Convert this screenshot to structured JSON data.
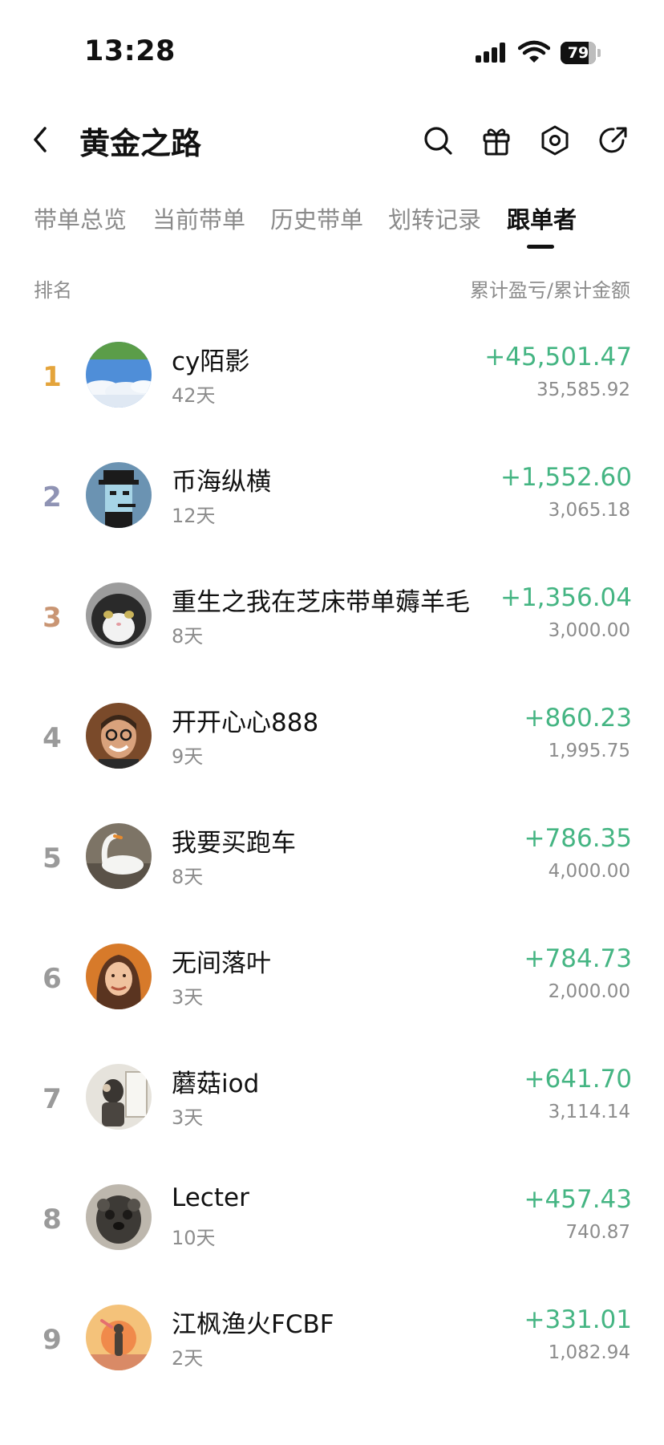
{
  "status_bar": {
    "time": "13:28",
    "battery": "79",
    "battery_level": 0.79
  },
  "header": {
    "title": "黄金之路",
    "icons": [
      "back-icon",
      "search-icon",
      "gift-icon",
      "settings-icon",
      "share-icon"
    ]
  },
  "tabs": [
    {
      "label": "带单总览",
      "active": false
    },
    {
      "label": "当前带单",
      "active": false
    },
    {
      "label": "历史带单",
      "active": false
    },
    {
      "label": "划转记录",
      "active": false
    },
    {
      "label": "跟单者",
      "active": true
    }
  ],
  "list_header": {
    "left": "排名",
    "right": "累计盈亏/累计金额"
  },
  "followers": [
    {
      "rank": "1",
      "name": "cy陌影",
      "days": "42天",
      "pnl": "+45,501.47",
      "amount": "35,585.92"
    },
    {
      "rank": "2",
      "name": "币海纵横",
      "days": "12天",
      "pnl": "+1,552.60",
      "amount": "3,065.18"
    },
    {
      "rank": "3",
      "name": "重生之我在芝床带单薅羊毛",
      "days": "8天",
      "pnl": "+1,356.04",
      "amount": "3,000.00"
    },
    {
      "rank": "4",
      "name": "开开心心888",
      "days": "9天",
      "pnl": "+860.23",
      "amount": "1,995.75"
    },
    {
      "rank": "5",
      "name": "我要买跑车",
      "days": "8天",
      "pnl": "+786.35",
      "amount": "4,000.00"
    },
    {
      "rank": "6",
      "name": "无间落叶",
      "days": "3天",
      "pnl": "+784.73",
      "amount": "2,000.00"
    },
    {
      "rank": "7",
      "name": "蘑菇iod",
      "days": "3天",
      "pnl": "+641.70",
      "amount": "3,114.14"
    },
    {
      "rank": "8",
      "name": "Lecter",
      "days": "10天",
      "pnl": "+457.43",
      "amount": "740.87"
    },
    {
      "rank": "9",
      "name": "江枫渔火FCBF",
      "days": "2天",
      "pnl": "+331.01",
      "amount": "1,082.94"
    }
  ],
  "colors": {
    "profit_green": "#45b583",
    "rank_gold": "#e4a43b",
    "rank_silver": "#8f93b4",
    "rank_bronze": "#c99573",
    "muted_text": "#8c8c8c"
  }
}
